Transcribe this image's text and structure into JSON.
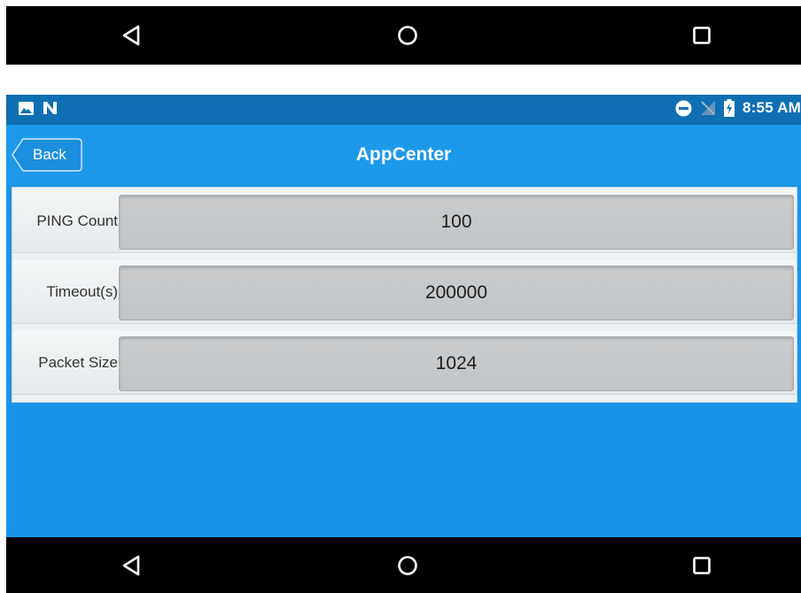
{
  "status_bar": {
    "time": "8:55 AM",
    "left_icons": [
      "image-icon",
      "n-icon"
    ],
    "right_icons": [
      "do-not-disturb-icon",
      "no-signal-icon",
      "battery-charging-icon"
    ]
  },
  "app": {
    "title": "AppCenter",
    "back_label": "Back"
  },
  "form": {
    "rows": [
      {
        "label": "PING Count",
        "value": "100"
      },
      {
        "label": "Timeout(s)",
        "value": "200000"
      },
      {
        "label": "Packet Size",
        "value": "1024"
      }
    ]
  },
  "nav_bar": {
    "buttons": [
      "back-icon",
      "home-icon",
      "recents-icon"
    ]
  },
  "colors": {
    "screen_bg": "#1a94e8",
    "status_bar": "#0e6fb2",
    "nav_bar": "#000000"
  }
}
